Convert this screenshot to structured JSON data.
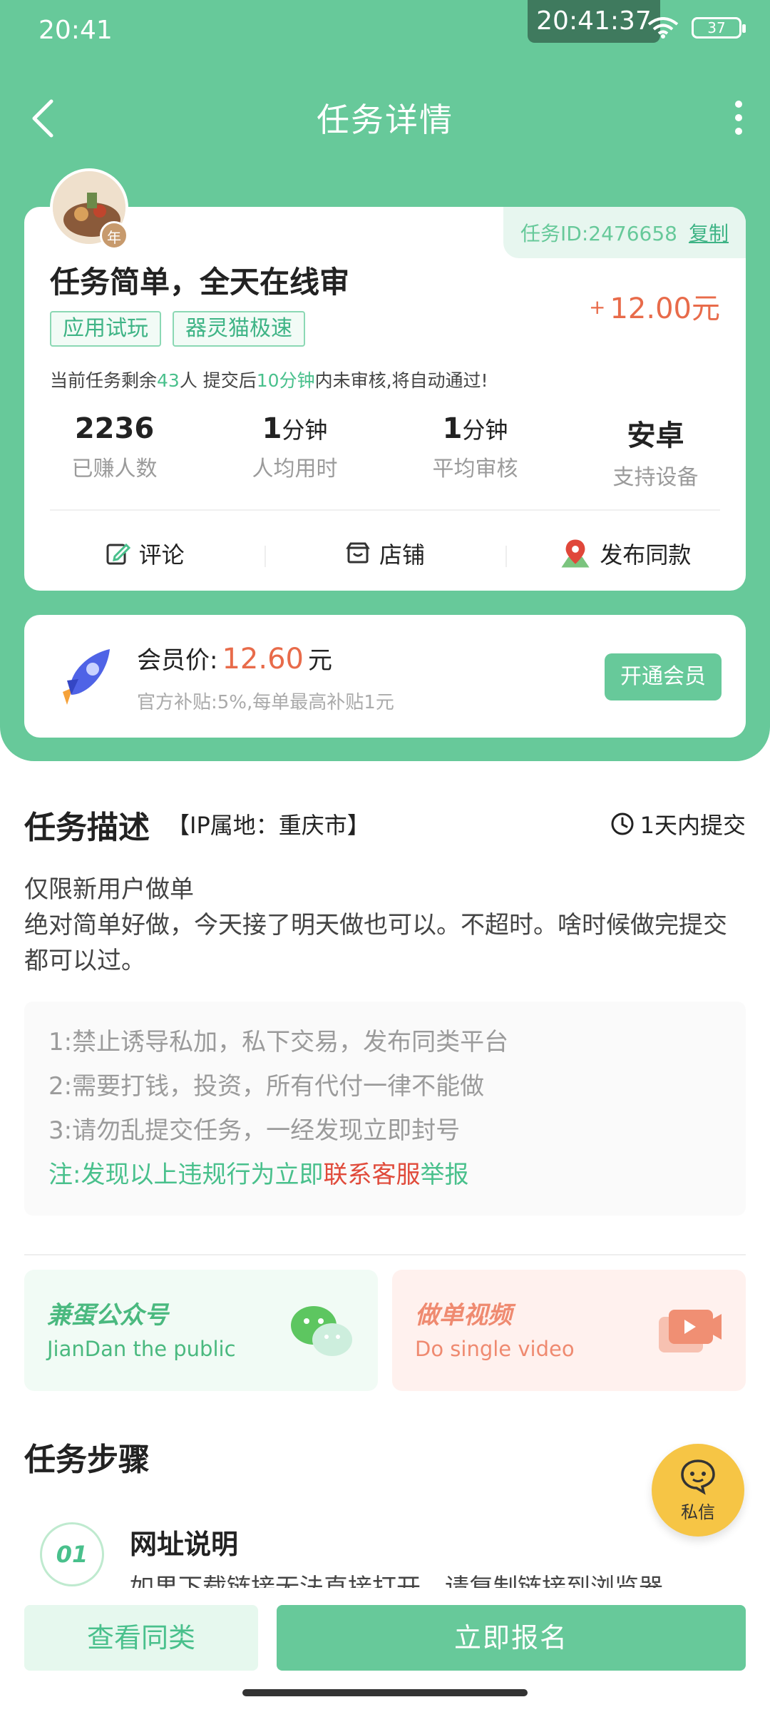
{
  "status": {
    "time": "20:41",
    "clock_overlay": "20:41:37",
    "battery": "37"
  },
  "nav": {
    "title": "任务详情"
  },
  "task": {
    "id_label": "任务ID:2476658",
    "copy_label": "复制",
    "title": "任务简单，全天在线审",
    "tags": [
      "应用试玩",
      "器灵猫极速"
    ],
    "price_prefix": "+",
    "price": "12.00元",
    "notice": {
      "p1": "当前任务剩余",
      "remaining": "43",
      "p2": "人 提交后",
      "minutes": "10分钟",
      "p3": "内未审核,将自动通过!"
    },
    "avatar_badge": "年",
    "stats": [
      {
        "value": "2236",
        "unit": "",
        "label": "已赚人数"
      },
      {
        "value": "1",
        "unit": "分钟",
        "label": "人均用时"
      },
      {
        "value": "1",
        "unit": "分钟",
        "label": "平均审核"
      },
      {
        "value": "安卓",
        "unit": "",
        "label": "支持设备"
      }
    ],
    "actions": [
      {
        "label": "评论",
        "icon": "edit-icon"
      },
      {
        "label": "店铺",
        "icon": "shop-icon"
      },
      {
        "label": "发布同款",
        "icon": "location-pin-icon"
      }
    ]
  },
  "member": {
    "label": "会员价:",
    "value": "12.60",
    "unit": "元",
    "note": "官方补贴:5%,每单最高补贴1元",
    "button": "开通会员"
  },
  "description": {
    "title": "任务描述",
    "ip": "【IP属地：重庆市】",
    "submit_time": "1天内提交",
    "lines": [
      "仅限新用户做单",
      "绝对简单好做，今天接了明天做也可以。不超时。啥时候做完提交都可以过。"
    ],
    "rules": [
      "1:禁止诱导私加，私下交易，发布同类平台",
      "2:需要打钱，投资，所有代付一律不能做",
      "3:请勿乱提交任务，一经发现立即封号"
    ],
    "rule_note": {
      "p1": "注:发现以上违规行为立即",
      "red": "联系客服",
      "p2": "举报"
    }
  },
  "promos": [
    {
      "title": "兼蛋公众号",
      "sub": "JianDan the public",
      "icon": "wechat-icon"
    },
    {
      "title": "做单视频",
      "sub": "Do single video",
      "icon": "video-icon"
    }
  ],
  "steps": {
    "title": "任务步骤",
    "items": [
      {
        "num": "01",
        "title": "网址说明",
        "text": "如果下载链接无法直接打开，请复制链接到浏览器"
      }
    ]
  },
  "dm": {
    "label": "私信"
  },
  "bottom": {
    "similar": "查看同类",
    "apply": "立即报名"
  },
  "colors": {
    "brand": "#67c99a",
    "price": "#e86b4a",
    "warning": "#e04a3a"
  }
}
